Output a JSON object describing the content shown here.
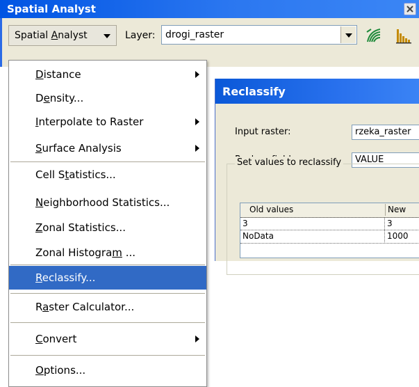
{
  "toolbar": {
    "title": "Spatial Analyst",
    "close_icon": "close-icon",
    "menu_button": {
      "pre": "Spatial ",
      "mnemonic": "A",
      "post": "nalyst"
    },
    "layer_label": "Layer:",
    "layer_value": "drogi_raster",
    "icons": [
      "histogram-fingerprint-icon",
      "histogram-icon"
    ]
  },
  "dialog": {
    "title": "Reclassify",
    "input_raster_label": "Input raster:",
    "input_raster_value": "rzeka_raster",
    "reclass_field_label": "Reclass field:",
    "reclass_field_value": "VALUE",
    "group_label": "Set values to reclassify",
    "table": {
      "headers": [
        "Old values",
        "New"
      ],
      "rows": [
        [
          "3",
          "3"
        ],
        [
          "NoData",
          "1000"
        ]
      ]
    }
  },
  "menu": {
    "items": [
      {
        "pre": "",
        "mnemonic": "D",
        "post": "istance",
        "submenu": true,
        "selected": false
      },
      {
        "pre": "D",
        "mnemonic": "e",
        "post": "nsity...",
        "submenu": false,
        "selected": false
      },
      {
        "pre": "",
        "mnemonic": "I",
        "post": "nterpolate to Raster",
        "submenu": true,
        "selected": false
      },
      {
        "pre": "",
        "mnemonic": "S",
        "post": "urface Analysis",
        "submenu": true,
        "selected": false
      },
      {
        "pre": "Cell S",
        "mnemonic": "t",
        "post": "atistics...",
        "submenu": false,
        "selected": false
      },
      {
        "pre": "",
        "mnemonic": "N",
        "post": "eighborhood Statistics...",
        "submenu": false,
        "selected": false
      },
      {
        "pre": "",
        "mnemonic": "Z",
        "post": "onal Statistics...",
        "submenu": false,
        "selected": false
      },
      {
        "pre": "Zonal Histogra",
        "mnemonic": "m",
        "post": " ...",
        "submenu": false,
        "selected": false
      },
      {
        "pre": "",
        "mnemonic": "R",
        "post": "eclassify...",
        "submenu": false,
        "selected": true
      },
      {
        "pre": "R",
        "mnemonic": "a",
        "post": "ster Calculator...",
        "submenu": false,
        "selected": false
      },
      {
        "pre": "",
        "mnemonic": "C",
        "post": "onvert",
        "submenu": true,
        "selected": false
      },
      {
        "pre": "",
        "mnemonic": "O",
        "post": "ptions...",
        "submenu": false,
        "selected": false
      }
    ]
  }
}
